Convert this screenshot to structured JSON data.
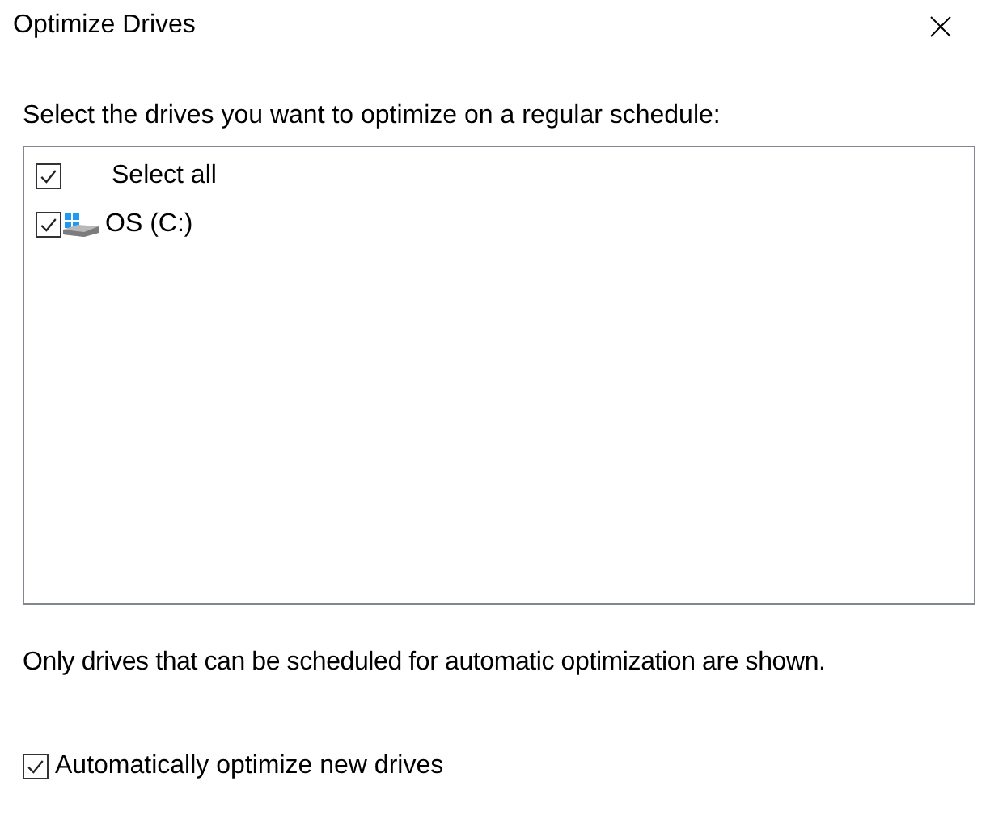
{
  "window": {
    "title": "Optimize Drives"
  },
  "instruction": "Select the drives you want to optimize on a regular schedule:",
  "drives": [
    {
      "kind": "select-all",
      "label": "Select all",
      "checked": true
    },
    {
      "kind": "drive",
      "label": "OS (C:)",
      "checked": true
    }
  ],
  "note": "Only drives that can be scheduled for automatic optimization are shown.",
  "auto_optimize": {
    "label": "Automatically optimize new drives",
    "checked": true
  }
}
